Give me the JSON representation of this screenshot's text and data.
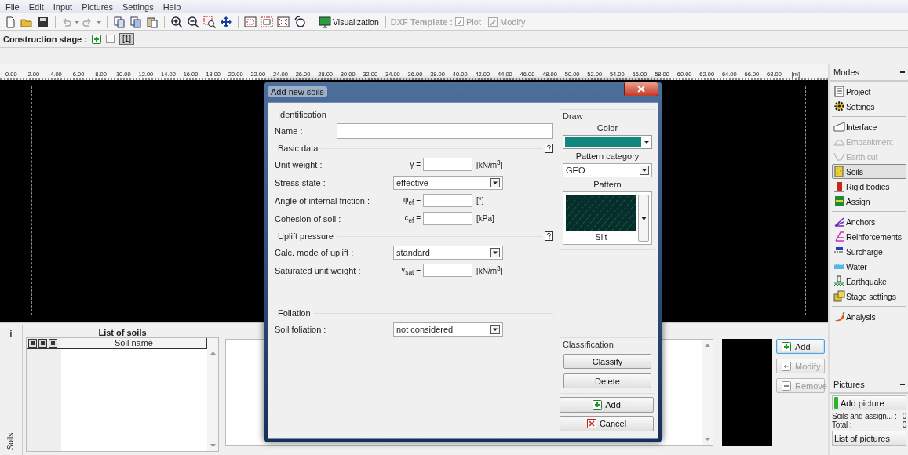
{
  "menu": [
    "File",
    "Edit",
    "Input",
    "Pictures",
    "Settings",
    "Help"
  ],
  "toolbar": {
    "visualization": "Visualization",
    "dxf_template": "DXF Template :",
    "plot": {
      "label": "Plot",
      "checked": true,
      "disabled": true
    },
    "modify": {
      "label": "Modify",
      "disabled": true
    }
  },
  "construction_stage": {
    "label": "Construction stage :",
    "stages": [
      {
        "label": "[1]",
        "selected": true
      }
    ]
  },
  "ruler": {
    "ticks": [
      "0.00",
      "2.00",
      "4.00",
      "6.00",
      "8.00",
      "10.00",
      "12.00",
      "14.00",
      "16.00",
      "18.00",
      "20.00",
      "22.00",
      "24.00",
      "26.00",
      "28.00",
      "30.00",
      "32.00",
      "34.00",
      "36.00",
      "38.00",
      "40.00",
      "42.00",
      "44.00",
      "46.00",
      "48.00",
      "50.00",
      "52.00",
      "54.00",
      "56.00",
      "58.00",
      "60.00",
      "62.00",
      "64.00",
      "66.00",
      "68.00"
    ],
    "unit": "[m]"
  },
  "list_of_soils": {
    "info": "i",
    "title": "List of soils",
    "side_label": "Soils",
    "column": "Soil name"
  },
  "soil_buttons": [
    {
      "label": "Add",
      "disabled": false,
      "focused": true
    },
    {
      "label": "Modify",
      "disabled": true,
      "focused": false
    },
    {
      "label": "Remove",
      "disabled": true,
      "focused": false
    }
  ],
  "modes": {
    "title": "Modes",
    "groups": [
      [
        {
          "label": "Project",
          "disabled": false,
          "selected": false
        },
        {
          "label": "Settings",
          "disabled": false,
          "selected": false
        }
      ],
      [
        {
          "label": "Interface",
          "disabled": false,
          "selected": false
        },
        {
          "label": "Embankment",
          "disabled": true,
          "selected": false
        },
        {
          "label": "Earth cut",
          "disabled": true,
          "selected": false
        },
        {
          "label": "Soils",
          "disabled": false,
          "selected": true
        },
        {
          "label": "Rigid bodies",
          "disabled": false,
          "selected": false
        },
        {
          "label": "Assign",
          "disabled": false,
          "selected": false
        }
      ],
      [
        {
          "label": "Anchors",
          "disabled": false,
          "selected": false
        },
        {
          "label": "Reinforcements",
          "disabled": false,
          "selected": false
        },
        {
          "label": "Surcharge",
          "disabled": false,
          "selected": false
        },
        {
          "label": "Water",
          "disabled": false,
          "selected": false
        },
        {
          "label": "Earthquake",
          "disabled": false,
          "selected": false
        },
        {
          "label": "Stage settings",
          "disabled": false,
          "selected": false
        }
      ],
      [
        {
          "label": "Analysis",
          "disabled": false,
          "selected": false
        }
      ]
    ]
  },
  "pictures": {
    "title": "Pictures",
    "add_button": "Add picture",
    "counts": [
      {
        "label": "Soils and assign... :",
        "value": "0"
      },
      {
        "label": "Total :",
        "value": "0"
      }
    ],
    "list_button": "List of pictures"
  },
  "dialog": {
    "title": "Add new soils",
    "sections": [
      {
        "title": "Identification",
        "help": false,
        "rows": [
          {
            "kind": "text",
            "label": "Name :"
          }
        ]
      },
      {
        "title": "Basic data",
        "help": true,
        "rows": [
          {
            "kind": "number",
            "label": "Unit weight :",
            "symbol": "γ =",
            "unit": "[kN/m$^{3}$]"
          },
          {
            "kind": "select",
            "label": "Stress-state :",
            "value": "effective"
          },
          {
            "kind": "number",
            "label": "Angle of internal friction :",
            "symbol": "φ$_{ef}$ =",
            "unit": "[°]"
          },
          {
            "kind": "number",
            "label": "Cohesion of soil :",
            "symbol": "c$_{ef}$ =",
            "unit": "[kPa]"
          }
        ]
      },
      {
        "title": "Uplift pressure",
        "help": true,
        "rows": [
          {
            "kind": "select",
            "label": "Calc. mode of uplift :",
            "value": "standard"
          },
          {
            "kind": "number",
            "label": "Saturated unit weight :",
            "symbol": "γ$_{sat}$ =",
            "unit": "[kN/m$^{3}$]"
          }
        ]
      },
      {
        "title": "Foliation",
        "help": false,
        "rows": [
          {
            "kind": "select",
            "label": "Soil foliation :",
            "value": "not considered"
          }
        ]
      }
    ],
    "draw": {
      "title": "Draw",
      "color_label": "Color",
      "color": "#10877f",
      "pattern_category_label": "Pattern category",
      "pattern_category": "GEO",
      "pattern_label": "Pattern",
      "pattern": "Silt"
    },
    "classification": {
      "title": "Classification",
      "buttons": [
        "Classify",
        "Delete"
      ]
    },
    "add": "Add",
    "cancel": "Cancel"
  }
}
